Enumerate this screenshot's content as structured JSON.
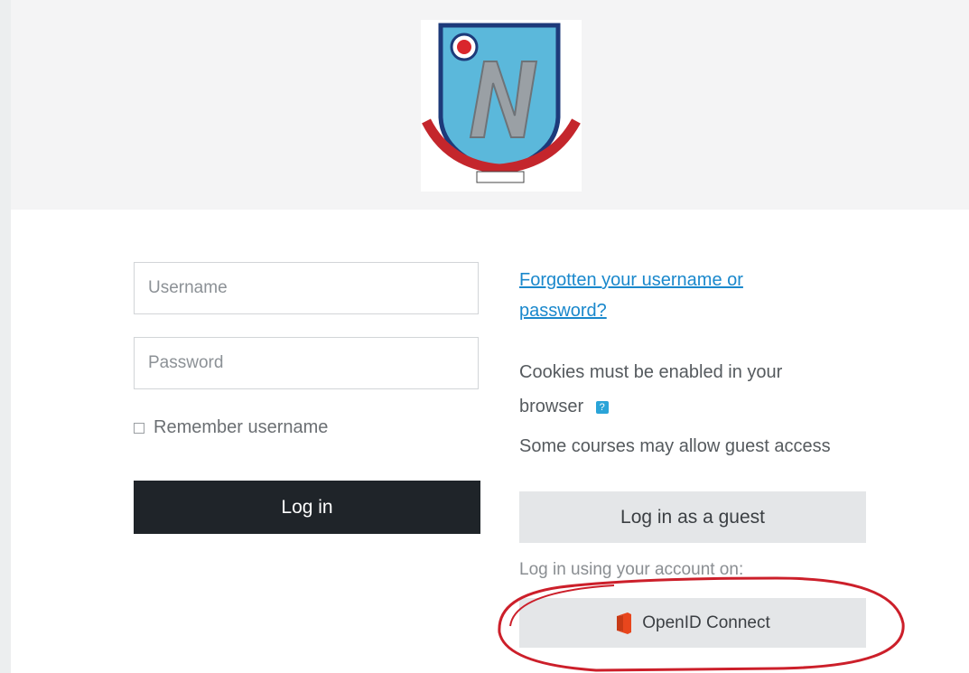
{
  "header": {
    "logo": {
      "kind": "school-crest-logo",
      "letter": "N"
    }
  },
  "login_form": {
    "username_placeholder": "Username",
    "password_placeholder": "Password",
    "remember_label": "Remember username",
    "login_label": "Log in"
  },
  "side_panel": {
    "forgot_link": "Forgotten your username or password?",
    "cookies_text": "Cookies must be enabled in your browser",
    "cookies_help_icon": "help-icon",
    "guest_text": "Some courses may allow guest access",
    "guest_button": "Log in as a guest",
    "using_account_text": "Log in using your account on:",
    "openid_button": "OpenID Connect",
    "openid_icon": "office-icon"
  },
  "colors": {
    "header_bg": "#f4f4f5",
    "primary_button": "#1f2429",
    "link": "#1a88cc",
    "annotation_circle": "#cc1f2a"
  }
}
